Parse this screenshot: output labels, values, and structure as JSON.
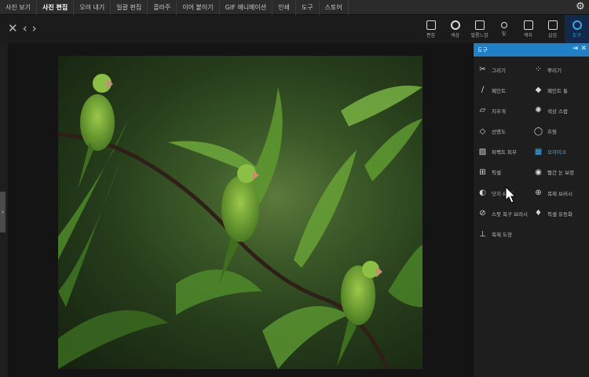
{
  "menu": [
    {
      "label": "사진 보기",
      "active": false
    },
    {
      "label": "사진 편집",
      "active": true
    },
    {
      "label": "오려 내기",
      "active": false
    },
    {
      "label": "일괄 편집",
      "active": false
    },
    {
      "label": "콜라주",
      "active": false
    },
    {
      "label": "이어 붙이기",
      "active": false
    },
    {
      "label": "GIF 애니메이션",
      "active": false
    },
    {
      "label": "인쇄",
      "active": false
    },
    {
      "label": "도구",
      "active": false
    },
    {
      "label": "스토어",
      "active": false
    }
  ],
  "nav": {
    "close": "✕",
    "prev": "‹",
    "next": "›"
  },
  "toolbar": [
    {
      "label": "편집",
      "icon": "edit-icon"
    },
    {
      "label": "색상",
      "icon": "color-icon"
    },
    {
      "label": "필름느낌",
      "icon": "film-icon"
    },
    {
      "label": "빛",
      "icon": "light-icon"
    },
    {
      "label": "액자",
      "icon": "frame-icon"
    },
    {
      "label": "삽입",
      "icon": "insert-icon"
    },
    {
      "label": "도구",
      "icon": "tools-icon"
    }
  ],
  "panel": {
    "title": "도구",
    "pin": "⇥",
    "close": "✕",
    "tools": [
      {
        "label": "그리기",
        "glyph": "✂"
      },
      {
        "label": "뿌리기",
        "glyph": "⁘"
      },
      {
        "label": "페인트",
        "glyph": "∕"
      },
      {
        "label": "페인트 통",
        "glyph": "◆"
      },
      {
        "label": "지우개",
        "glyph": "▱"
      },
      {
        "label": "색상 스왑",
        "glyph": "✺"
      },
      {
        "label": "선명도",
        "glyph": "◇"
      },
      {
        "label": "흐림",
        "glyph": "◯"
      },
      {
        "label": "퍼펙트 피부",
        "glyph": "▨"
      },
      {
        "label": "모자이크",
        "glyph": "▦"
      },
      {
        "label": "픽셀",
        "glyph": "⊞"
      },
      {
        "label": "빨간 눈 보정",
        "glyph": "◉"
      },
      {
        "label": "닷지 & 번",
        "glyph": "◐"
      },
      {
        "label": "복제 브러시",
        "glyph": "⊕"
      },
      {
        "label": "스팟 복구 브러시",
        "glyph": "⊘"
      },
      {
        "label": "픽셀 유동화",
        "glyph": "♦"
      },
      {
        "label": "복제 도장",
        "glyph": "⊥"
      }
    ]
  },
  "side_tab": "›",
  "gear": "⚙"
}
